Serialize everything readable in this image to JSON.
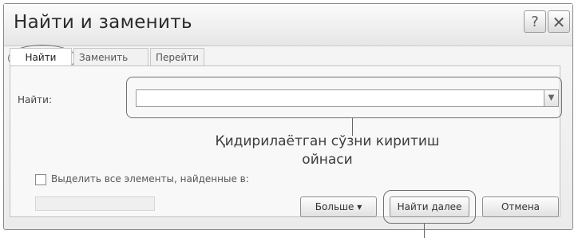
{
  "window": {
    "title": "Найти и заменить"
  },
  "titlebar": {
    "help_glyph": "?",
    "close_glyph": "✕"
  },
  "tabs": [
    {
      "label": "Найти",
      "selected": true
    },
    {
      "label": "Заменить",
      "selected": false
    },
    {
      "label": "Перейти",
      "selected": false
    }
  ],
  "find": {
    "label": "Найти:",
    "value": "",
    "placeholder": ""
  },
  "annotation": {
    "text": "Қидирилаётган сўзни киритиш ойнаси"
  },
  "highlight": {
    "checked": false,
    "label": "Выделить все элементы, найденные в:",
    "dropdown_value": ""
  },
  "buttons": {
    "more": "Больше ▾",
    "find_next": "Найти далее",
    "cancel": "Отмена"
  }
}
